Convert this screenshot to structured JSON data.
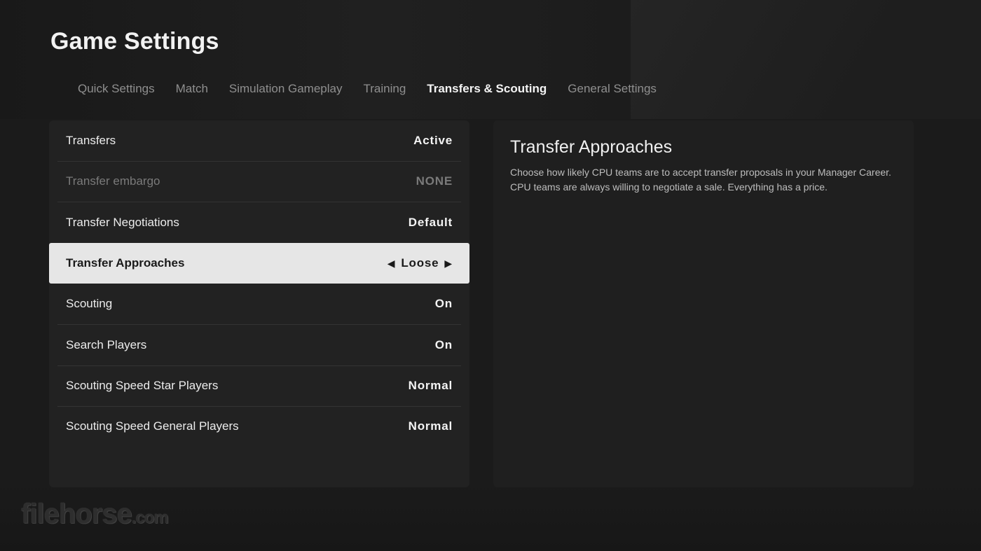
{
  "page": {
    "title": "Game Settings"
  },
  "tabs": [
    {
      "label": "Quick Settings"
    },
    {
      "label": "Match"
    },
    {
      "label": "Simulation Gameplay"
    },
    {
      "label": "Training"
    },
    {
      "label": "Transfers & Scouting",
      "active": true
    },
    {
      "label": "General Settings"
    }
  ],
  "settings": [
    {
      "label": "Transfers",
      "value": "Active"
    },
    {
      "label": "Transfer embargo",
      "value": "NONE",
      "disabled": true
    },
    {
      "label": "Transfer Negotiations",
      "value": "Default"
    },
    {
      "label": "Transfer Approaches",
      "value": "Loose",
      "selected": true,
      "left_arrow": "◀",
      "right_arrow": "▶"
    },
    {
      "label": "Scouting",
      "value": "On"
    },
    {
      "label": "Search Players",
      "value": "On"
    },
    {
      "label": "Scouting Speed Star Players",
      "value": "Normal"
    },
    {
      "label": "Scouting Speed General Players",
      "value": "Normal"
    }
  ],
  "info": {
    "title": "Transfer Approaches",
    "description": "Choose how likely CPU teams are to accept transfer proposals in your Manager Career. CPU teams are always willing to negotiate a sale. Everything has a price."
  },
  "watermark": {
    "main": "filehorse",
    "suffix": ".com"
  },
  "colors": {
    "selected_row_bg": "#e6e6e6",
    "panel_bg": "#222222",
    "background": "#1b1b1b"
  }
}
